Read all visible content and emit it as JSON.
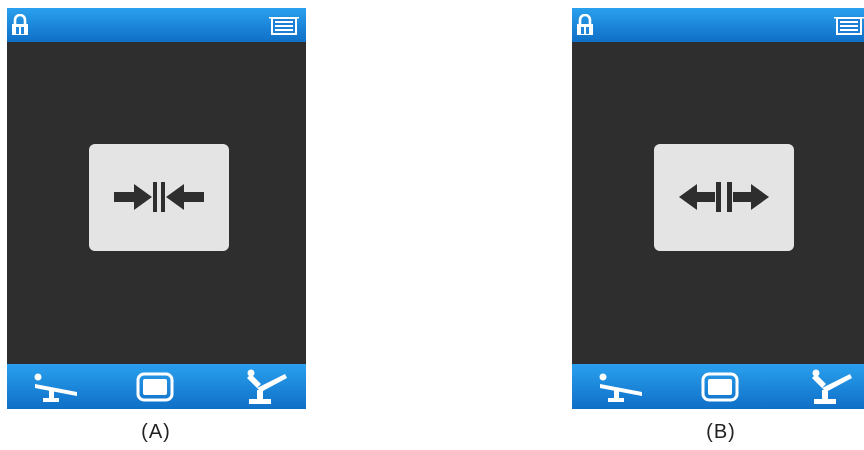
{
  "panels": [
    {
      "caption": "(A)",
      "topbar": {
        "left_icon": "lock-icon",
        "right_icon": "menu-icon"
      },
      "center_button": {
        "icon": "arrows-inward-icon"
      },
      "bottombar": {
        "icons": [
          "chair-recline-icon",
          "monitor-icon",
          "chair-upright-icon"
        ]
      }
    },
    {
      "caption": "(B)",
      "topbar": {
        "left_icon": "lock-icon",
        "right_icon": "menu-icon"
      },
      "center_button": {
        "icon": "arrows-outward-icon"
      },
      "bottombar": {
        "icons": [
          "chair-recline-icon",
          "monitor-icon",
          "chair-upright-icon"
        ]
      }
    }
  ],
  "colors": {
    "bar_top": "#2aa0ee",
    "bar_bottom": "#0f6fc7",
    "screen_bg": "#2e2e2e",
    "card_bg": "#e4e4e4",
    "icon_dark": "#2e2e2e",
    "icon_light": "#ffffff"
  }
}
